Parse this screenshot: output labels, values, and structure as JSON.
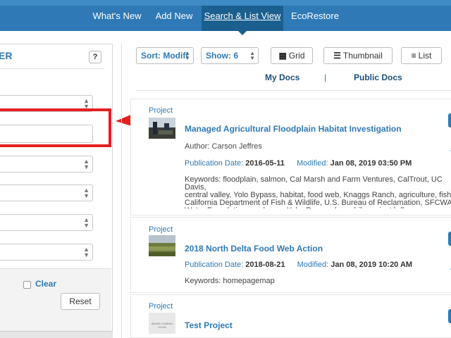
{
  "nav": {
    "items": [
      {
        "label": "What's New",
        "active": false
      },
      {
        "label": "Add New",
        "active": false
      },
      {
        "label": "Search & List View",
        "active": true
      },
      {
        "label": "EcoRestore",
        "active": false
      }
    ]
  },
  "filter": {
    "title": "ER",
    "help_label": "?",
    "clear_label": "Clear",
    "reset_label": "Reset"
  },
  "toolbar": {
    "sort_label": "Sort: Modifi",
    "show_label": "Show: 6",
    "grid_label": "Grid",
    "thumbnail_label": "Thumbnail",
    "list_label": "List"
  },
  "tabs": {
    "my_docs": "My Docs",
    "separator": "|",
    "public_docs": "Public Docs"
  },
  "results": [
    {
      "type": "Project",
      "title": "Managed Agricultural Floodplain Habitat Investigation",
      "author_label": "Author:",
      "author": "Carson Jeffres",
      "pub_label": "Publication Date:",
      "pub_date": "2016-05-11",
      "mod_label": "Modified:",
      "mod_date": "Jan 08, 2019 03:50 PM",
      "keywords": "Keywords: floodplain, salmon, Cal Marsh and Farm Ventures, CalTrout, UC Davis,\ncentral valley, Yolo Bypass, habitat, food web, Knaggs Ranch, agriculture, fish,\nCalifornia Department of Fish & Wildlife, U.S. Bureau of Reclamation, SFCWA,\nWater Foundation,sarahmap, Yolo, Research, mobile.project.bdl, homepagemap"
    },
    {
      "type": "Project",
      "title": "2018 North Delta Food Web Action",
      "pub_label": "Publication Date:",
      "pub_date": "2018-08-21",
      "mod_label": "Modified:",
      "mod_date": "Jan 08, 2019 10:20 AM",
      "keywords": "Keywords: homepagemap"
    },
    {
      "type": "Project",
      "title": "Test Project",
      "thumb_text": "IMAGE COMING SOON"
    }
  ]
}
